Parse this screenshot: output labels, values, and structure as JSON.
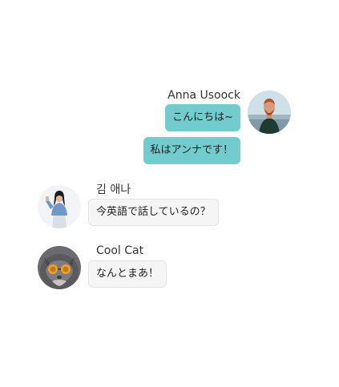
{
  "colors": {
    "own_bubble": "#72cbcc",
    "other_bubble": "#f5f5f5",
    "background": "#ffffff",
    "text": "#333333"
  },
  "messages": [
    {
      "sender": "Anna Usoock",
      "side": "right",
      "avatar": "avatar-photo-man-dark-sweater",
      "texts": [
        "こんにちは~",
        "私はアンナです！"
      ]
    },
    {
      "sender": "김 애나",
      "side": "left",
      "avatar": "avatar-photo-woman-white-outfit",
      "texts": [
        "今英語で話しているの？"
      ]
    },
    {
      "sender": "Cool Cat",
      "side": "left",
      "avatar": "avatar-photo-cat-sunglasses",
      "texts": [
        "なんとまあ！"
      ]
    }
  ]
}
